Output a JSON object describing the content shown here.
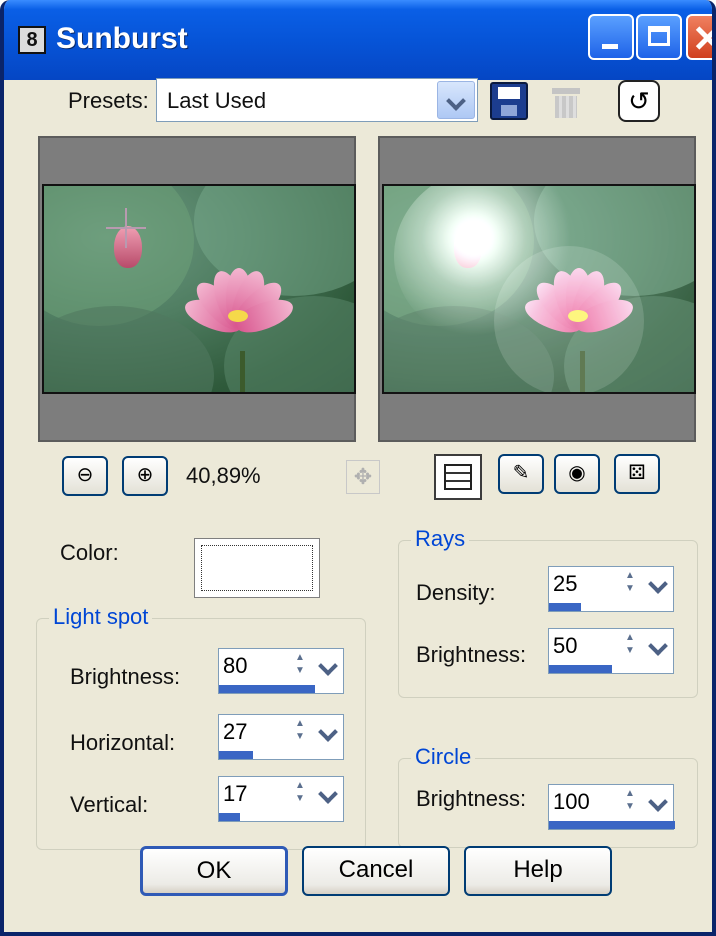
{
  "window": {
    "title": "Sunburst",
    "icon_text": "8"
  },
  "presets": {
    "label": "Presets:",
    "value": "Last Used"
  },
  "zoom": {
    "percent": "40,89%"
  },
  "color": {
    "label": "Color:",
    "value": "#ffffff"
  },
  "light_spot": {
    "title": "Light spot",
    "fields": [
      {
        "label": "Brightness:",
        "value": "80",
        "fill": 0.8
      },
      {
        "label": "Horizontal:",
        "value": "27",
        "fill": 0.27
      },
      {
        "label": "Vertical:",
        "value": "17",
        "fill": 0.17
      }
    ]
  },
  "rays": {
    "title": "Rays",
    "fields": [
      {
        "label": "Density:",
        "value": "25",
        "fill": 0.25
      },
      {
        "label": "Brightness:",
        "value": "50",
        "fill": 0.5
      }
    ]
  },
  "circle": {
    "title": "Circle",
    "fields": [
      {
        "label": "Brightness:",
        "value": "100",
        "fill": 1.0
      }
    ]
  },
  "buttons": {
    "ok": "OK",
    "cancel": "Cancel",
    "help": "Help"
  },
  "icons": [
    "save-icon",
    "trash-icon",
    "reset-icon",
    "zoom-out-icon",
    "zoom-in-icon",
    "pan-icon",
    "proof-icon",
    "randomize-icon"
  ],
  "colors": {
    "accent": "#0546c4",
    "group_title": "#0046d5",
    "value_bar": "#3a66c4"
  }
}
